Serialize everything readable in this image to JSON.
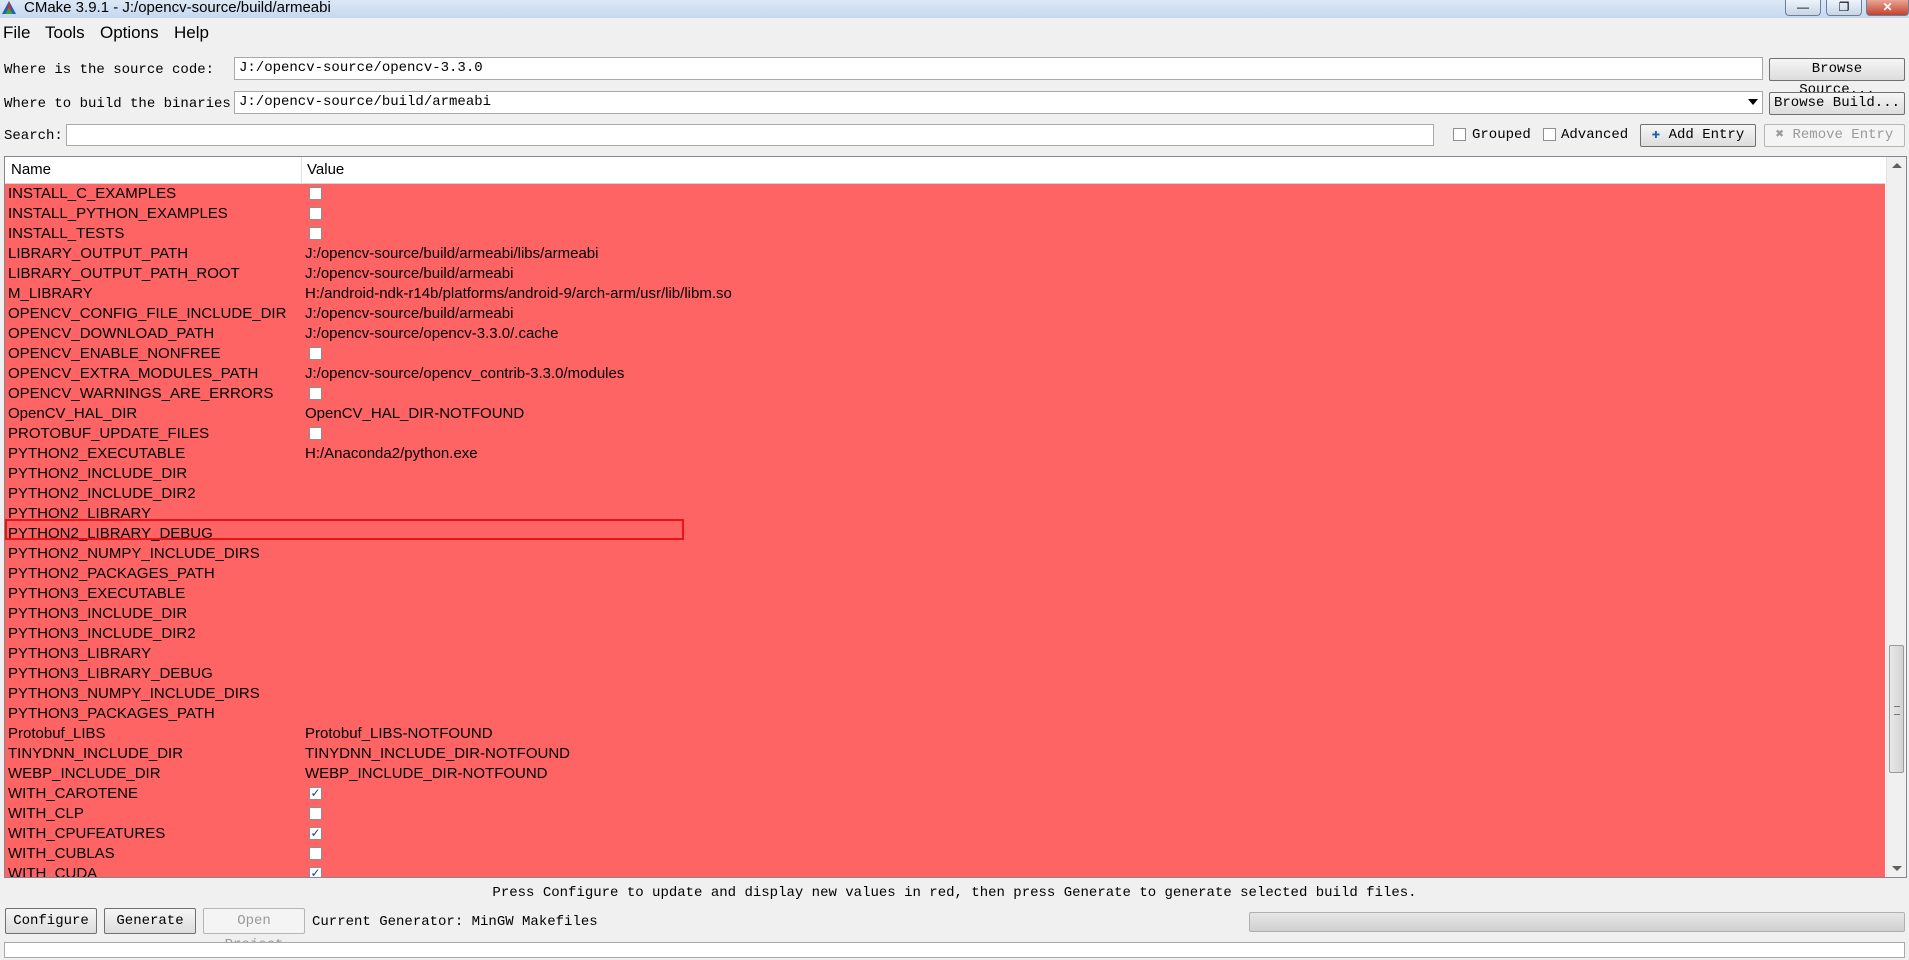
{
  "window": {
    "title": "CMake 3.9.1 - J:/opencv-source/build/armeabi",
    "minimize_glyph": "—",
    "maximize_glyph": "❐",
    "close_glyph": "✕"
  },
  "menu": [
    "File",
    "Tools",
    "Options",
    "Help"
  ],
  "source": {
    "label": "Where is the source code:",
    "value": "J:/opencv-source/opencv-3.3.0",
    "browse_label": "Browse Source..."
  },
  "binaries": {
    "label": "Where to build the binaries:",
    "value": "J:/opencv-source/build/armeabi",
    "browse_label": "Browse Build..."
  },
  "search": {
    "label": "Search:",
    "value": ""
  },
  "options": {
    "grouped_label": "Grouped",
    "grouped_checked": false,
    "advanced_label": "Advanced",
    "advanced_checked": false,
    "add_entry_label": "Add Entry",
    "remove_entry_label": "Remove Entry"
  },
  "table": {
    "columns": [
      "Name",
      "Value"
    ],
    "highlight_color": "#ff6464",
    "rows": [
      {
        "name": "INSTALL_C_EXAMPLES",
        "type": "bool",
        "checked": false,
        "value": ""
      },
      {
        "name": "INSTALL_PYTHON_EXAMPLES",
        "type": "bool",
        "checked": false,
        "value": ""
      },
      {
        "name": "INSTALL_TESTS",
        "type": "bool",
        "checked": false,
        "value": ""
      },
      {
        "name": "LIBRARY_OUTPUT_PATH",
        "type": "text",
        "value": "J:/opencv-source/build/armeabi/libs/armeabi"
      },
      {
        "name": "LIBRARY_OUTPUT_PATH_ROOT",
        "type": "text",
        "value": "J:/opencv-source/build/armeabi"
      },
      {
        "name": "M_LIBRARY",
        "type": "text",
        "value": "H:/android-ndk-r14b/platforms/android-9/arch-arm/usr/lib/libm.so"
      },
      {
        "name": "OPENCV_CONFIG_FILE_INCLUDE_DIR",
        "type": "text",
        "value": "J:/opencv-source/build/armeabi"
      },
      {
        "name": "OPENCV_DOWNLOAD_PATH",
        "type": "text",
        "value": "J:/opencv-source/opencv-3.3.0/.cache"
      },
      {
        "name": "OPENCV_ENABLE_NONFREE",
        "type": "bool",
        "checked": false,
        "value": ""
      },
      {
        "name": "OPENCV_EXTRA_MODULES_PATH",
        "type": "text",
        "value": "J:/opencv-source/opencv_contrib-3.3.0/modules"
      },
      {
        "name": "OPENCV_WARNINGS_ARE_ERRORS",
        "type": "bool",
        "checked": false,
        "value": ""
      },
      {
        "name": "OpenCV_HAL_DIR",
        "type": "text",
        "value": "OpenCV_HAL_DIR-NOTFOUND"
      },
      {
        "name": "PROTOBUF_UPDATE_FILES",
        "type": "bool",
        "checked": false,
        "value": ""
      },
      {
        "name": "PYTHON2_EXECUTABLE",
        "type": "text",
        "value": "H:/Anaconda2/python.exe"
      },
      {
        "name": "PYTHON2_INCLUDE_DIR",
        "type": "text",
        "value": ""
      },
      {
        "name": "PYTHON2_INCLUDE_DIR2",
        "type": "text",
        "value": ""
      },
      {
        "name": "PYTHON2_LIBRARY",
        "type": "text",
        "value": ""
      },
      {
        "name": "PYTHON2_LIBRARY_DEBUG",
        "type": "text",
        "value": ""
      },
      {
        "name": "PYTHON2_NUMPY_INCLUDE_DIRS",
        "type": "text",
        "value": ""
      },
      {
        "name": "PYTHON2_PACKAGES_PATH",
        "type": "text",
        "value": ""
      },
      {
        "name": "PYTHON3_EXECUTABLE",
        "type": "text",
        "value": ""
      },
      {
        "name": "PYTHON3_INCLUDE_DIR",
        "type": "text",
        "value": ""
      },
      {
        "name": "PYTHON3_INCLUDE_DIR2",
        "type": "text",
        "value": ""
      },
      {
        "name": "PYTHON3_LIBRARY",
        "type": "text",
        "value": ""
      },
      {
        "name": "PYTHON3_LIBRARY_DEBUG",
        "type": "text",
        "value": ""
      },
      {
        "name": "PYTHON3_NUMPY_INCLUDE_DIRS",
        "type": "text",
        "value": ""
      },
      {
        "name": "PYTHON3_PACKAGES_PATH",
        "type": "text",
        "value": ""
      },
      {
        "name": "Protobuf_LIBS",
        "type": "text",
        "value": "Protobuf_LIBS-NOTFOUND"
      },
      {
        "name": "TINYDNN_INCLUDE_DIR",
        "type": "text",
        "value": "TINYDNN_INCLUDE_DIR-NOTFOUND"
      },
      {
        "name": "WEBP_INCLUDE_DIR",
        "type": "text",
        "value": "WEBP_INCLUDE_DIR-NOTFOUND"
      },
      {
        "name": "WITH_CAROTENE",
        "type": "bool",
        "checked": true,
        "value": ""
      },
      {
        "name": "WITH_CLP",
        "type": "bool",
        "checked": false,
        "value": ""
      },
      {
        "name": "WITH_CPUFEATURES",
        "type": "bool",
        "checked": true,
        "value": ""
      },
      {
        "name": "WITH_CUBLAS",
        "type": "bool",
        "checked": false,
        "value": ""
      },
      {
        "name": "WITH_CUDA",
        "type": "bool",
        "checked": true,
        "value": ""
      }
    ]
  },
  "status": {
    "hint": "Press Configure to update and display new values in red, then press Generate to generate selected build files."
  },
  "footer": {
    "configure_label": "Configure",
    "generate_label": "Generate",
    "open_project_label": "Open Project",
    "generator_text": "Current Generator: MinGW Makefiles"
  }
}
